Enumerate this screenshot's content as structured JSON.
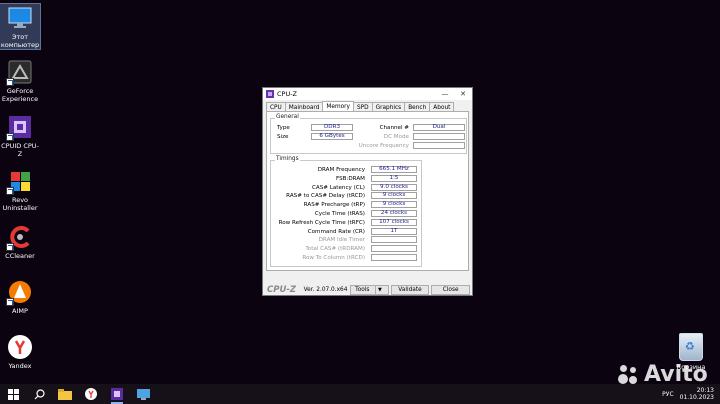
{
  "desktop": {
    "icons": [
      {
        "label": "Этот компьютер"
      },
      {
        "label": "GeForce Experience"
      },
      {
        "label": "CPUID CPU-Z"
      },
      {
        "label": "Revo Uninstaller"
      },
      {
        "label": "CCleaner"
      },
      {
        "label": "AIMP"
      },
      {
        "label": "Yandex"
      }
    ],
    "recycle_bin": "Корзина",
    "watermark": "Avito"
  },
  "window": {
    "title": "CPU-Z",
    "tabs": [
      "CPU",
      "Mainboard",
      "Memory",
      "SPD",
      "Graphics",
      "Bench",
      "About"
    ],
    "active_tab": "Memory",
    "general": {
      "title": "General",
      "type_label": "Type",
      "type_value": "DDR3",
      "size_label": "Size",
      "size_value": "6 GBytes",
      "channel_label": "Channel #",
      "channel_value": "Dual",
      "dc_mode_label": "DC Mode",
      "dc_mode_value": "",
      "uncore_label": "Uncore Frequency",
      "uncore_value": ""
    },
    "timings": {
      "title": "Timings",
      "rows": [
        {
          "label": "DRAM Frequency",
          "value": "665.1 MHz",
          "disabled": false
        },
        {
          "label": "FSB:DRAM",
          "value": "1:5",
          "disabled": false
        },
        {
          "label": "CAS# Latency (CL)",
          "value": "9.0 clocks",
          "disabled": false
        },
        {
          "label": "RAS# to CAS# Delay (tRCD)",
          "value": "9 clocks",
          "disabled": false
        },
        {
          "label": "RAS# Precharge (tRP)",
          "value": "9 clocks",
          "disabled": false
        },
        {
          "label": "Cycle Time (tRAS)",
          "value": "24 clocks",
          "disabled": false
        },
        {
          "label": "Row Refresh Cycle Time (tRFC)",
          "value": "107 clocks",
          "disabled": false
        },
        {
          "label": "Command Rate (CR)",
          "value": "1T",
          "disabled": false
        },
        {
          "label": "DRAM Idle Timer",
          "value": "",
          "disabled": true
        },
        {
          "label": "Total CAS# (tRDRAM)",
          "value": "",
          "disabled": true
        },
        {
          "label": "Row To Column (tRCD)",
          "value": "",
          "disabled": true
        }
      ]
    },
    "footer": {
      "brand": "CPU-Z",
      "version": "Ver. 2.07.0.x64",
      "tools_label": "Tools",
      "validate_label": "Validate",
      "close_label": "Close"
    }
  },
  "taskbar": {
    "language": "РУС",
    "time": "20:13",
    "date": "01.10.2023"
  }
}
